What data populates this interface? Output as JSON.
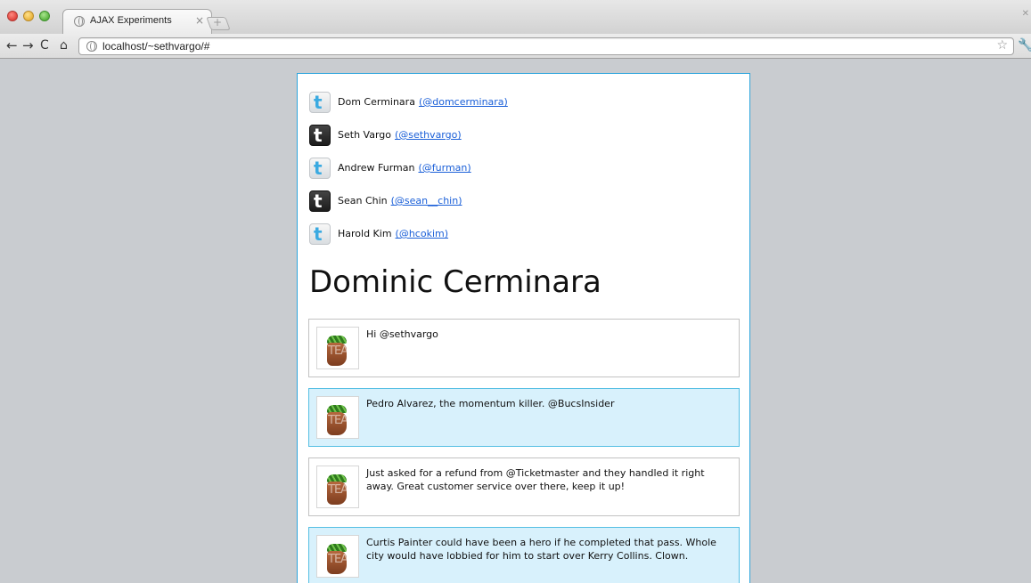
{
  "browser": {
    "tab_title": "AJAX Experiments",
    "tab_close": "×",
    "new_tab": "+",
    "url": "localhost/~sethvargo/#",
    "back": "←",
    "forward": "→",
    "reload": "C",
    "home": "⌂",
    "star": "☆",
    "wrench": "🔧",
    "corner": "✕"
  },
  "people": [
    {
      "name": "Dom Cerminara",
      "handle": "(@domcerminara)",
      "icon": "twitter-icon-blue"
    },
    {
      "name": "Seth Vargo",
      "handle": "(@sethvargo)",
      "icon": "twitter-icon-dark"
    },
    {
      "name": "Andrew Furman",
      "handle": "(@furman)",
      "icon": "twitter-icon-blue"
    },
    {
      "name": "Sean Chin",
      "handle": "(@sean__chin)",
      "icon": "twitter-icon-dark"
    },
    {
      "name": "Harold Kim",
      "handle": "(@hcokim)",
      "icon": "twitter-icon-blue"
    }
  ],
  "profile": {
    "title": "Dominic Cerminara"
  },
  "tweets": [
    {
      "text": "Hi @sethvargo",
      "highlighted": false
    },
    {
      "text": "Pedro Alvarez, the momentum killer. @BucsInsider",
      "highlighted": true
    },
    {
      "text": "Just asked for a refund from @Ticketmaster and they handled it right away. Great customer service over there, keep it up!",
      "highlighted": false
    },
    {
      "text": "Curtis Painter could have been a hero if he completed that pass. Whole city would have lobbied for him to start over Kerry Collins. Clown.",
      "highlighted": true
    }
  ],
  "avatar_overlay": "TEA",
  "colors": {
    "page_border": "#2ca4dc",
    "highlight_bg": "#d8f1fc",
    "link": "#1a5fd8"
  }
}
